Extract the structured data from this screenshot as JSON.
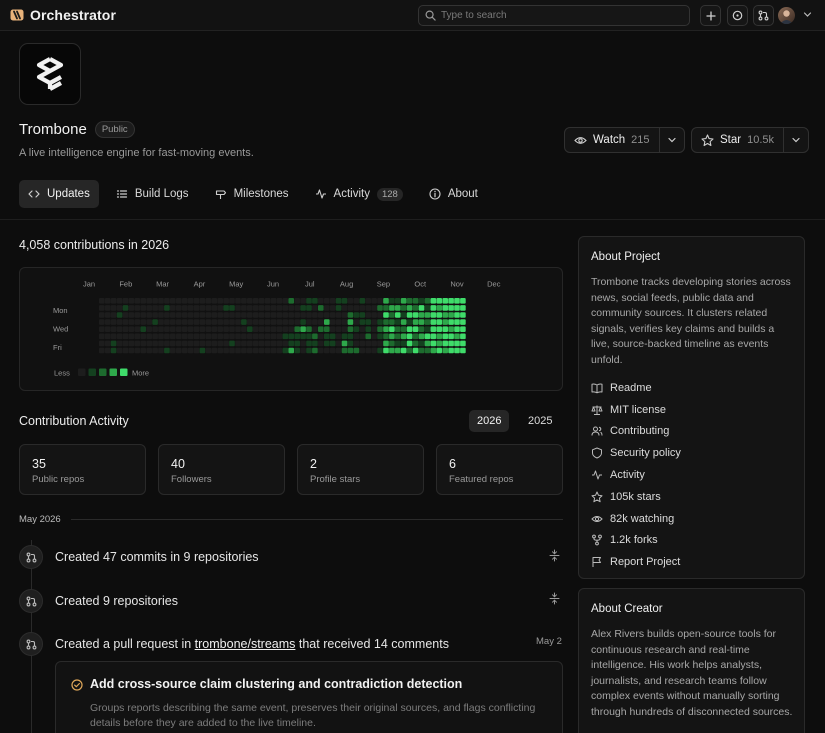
{
  "app": {
    "name": "Orchestrator"
  },
  "search": {
    "placeholder": "Type to search"
  },
  "repo": {
    "name": "Trombone",
    "visibility": "Public",
    "description": "A live intelligence engine for fast-moving events.",
    "watch": {
      "label": "Watch",
      "count": "215"
    },
    "star": {
      "label": "Star",
      "count": "10.5k"
    }
  },
  "tabs": [
    {
      "label": "Updates",
      "icon": "code-icon",
      "active": true
    },
    {
      "label": "Build Logs",
      "icon": "list-icon"
    },
    {
      "label": "Milestones",
      "icon": "signpost-icon"
    },
    {
      "label": "Activity",
      "icon": "pulse-icon",
      "count": "128"
    },
    {
      "label": "About",
      "icon": "info-icon"
    }
  ],
  "contributions": {
    "title": "4,058 contributions in 2026",
    "months": [
      "Jan",
      "Feb",
      "Mar",
      "Apr",
      "May",
      "Jun",
      "Jul",
      "Aug",
      "Sep",
      "Oct",
      "Nov",
      "Dec"
    ],
    "day_labels": [
      "Mon",
      "Wed",
      "Fri"
    ],
    "legend": {
      "less": "Less",
      "more": "More"
    },
    "colors": [
      "#1d1d1d",
      "#14401f",
      "#1d6b2e",
      "#2ea94b",
      "#3fdc6a"
    ]
  },
  "activity_section": {
    "title": "Contribution Activity",
    "years": [
      "2026",
      "2025"
    ],
    "active_year": "2026"
  },
  "stats": [
    {
      "value": "35",
      "label": "Public repos"
    },
    {
      "value": "40",
      "label": "Followers"
    },
    {
      "value": "2",
      "label": "Profile stars"
    },
    {
      "value": "6",
      "label": "Featured repos"
    }
  ],
  "timeline": {
    "month": "May 2026",
    "items": [
      {
        "text": "Created 47 commits in 9 repositories"
      },
      {
        "text": "Created 9 repositories"
      },
      {
        "prefix": "Created a pull request in ",
        "link": "trombone/streams",
        "suffix": " that received 14 comments",
        "date": "May 2"
      }
    ],
    "pr": {
      "title": "Add cross-source claim clustering and contradiction detection",
      "description": "Groups reports describing the same event, preserves their original sources, and flags conflicting details before they are added to the live timeline."
    }
  },
  "about_project": {
    "title": "About Project",
    "body": "Trombone tracks developing stories across news, social feeds, public data and community sources. It clusters related signals, verifies key claims and builds a live, source-backed timeline as events unfold.",
    "links": [
      {
        "label": "Readme",
        "icon": "book-icon"
      },
      {
        "label": "MIT license",
        "icon": "scale-icon"
      },
      {
        "label": "Contributing",
        "icon": "people-icon"
      },
      {
        "label": "Security policy",
        "icon": "shield-icon"
      },
      {
        "label": "Activity",
        "icon": "pulse-icon"
      },
      {
        "label": "105k stars",
        "icon": "star-icon"
      },
      {
        "label": "82k watching",
        "icon": "eye-icon"
      },
      {
        "label": "1.2k forks",
        "icon": "fork-icon"
      },
      {
        "label": "Report Project",
        "icon": "flag-icon"
      }
    ]
  },
  "about_creator": {
    "title": "About Creator",
    "body": "Alex Rivers builds open-source tools for continuous research and real-time intelligence. His work helps analysts, journalists, and research teams follow complex events without manually sorting through hundreds of disconnected sources."
  }
}
